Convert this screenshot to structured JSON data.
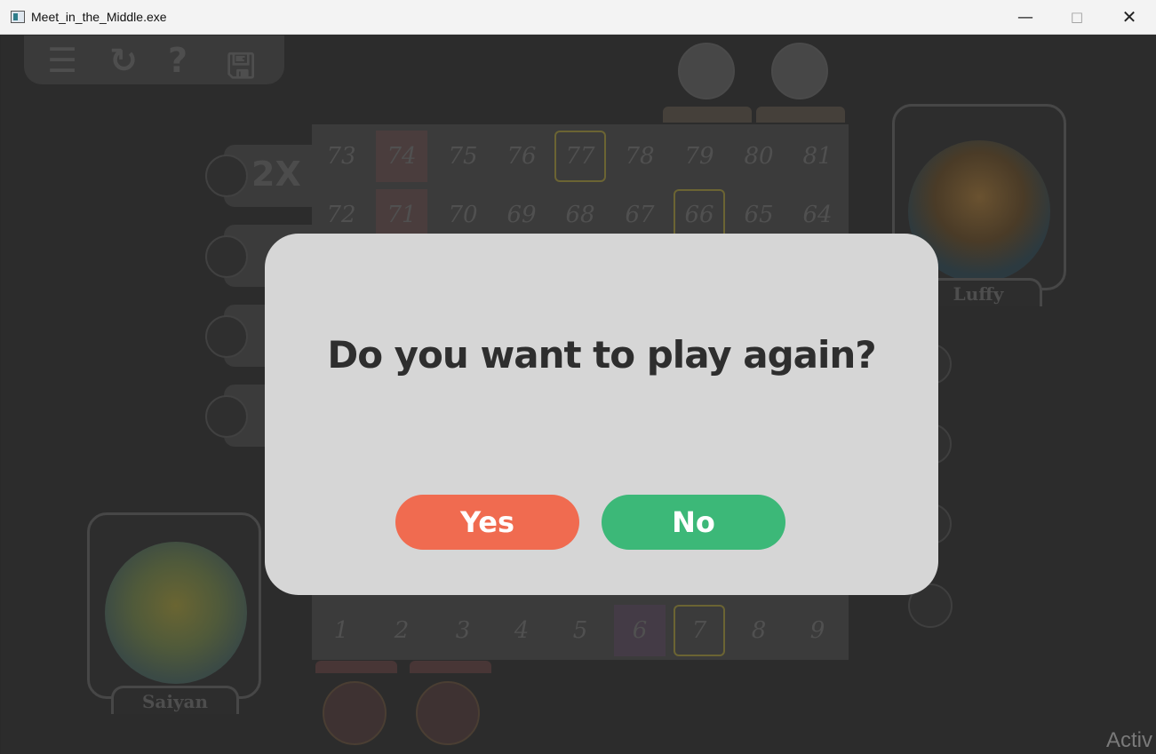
{
  "window": {
    "title": "Meet_in_the_Middle.exe"
  },
  "toolbar": {
    "icons": [
      "menu-icon",
      "restart-icon",
      "help-icon",
      "save-icon"
    ]
  },
  "board": {
    "top_row": [
      "73",
      "74",
      "75",
      "76",
      "77",
      "78",
      "79",
      "80",
      "81"
    ],
    "second_row": [
      "72",
      "71",
      "70",
      "69",
      "68",
      "67",
      "66",
      "65",
      "64"
    ],
    "bottom_row": [
      "1",
      "2",
      "3",
      "4",
      "5",
      "6",
      "7",
      "8",
      "9"
    ]
  },
  "side_panel": {
    "multiplier_label": "2X"
  },
  "players": {
    "top_player": "Luffy",
    "bottom_player": "Saiyan"
  },
  "dialog": {
    "question": "Do you want to play again?",
    "yes_label": "Yes",
    "no_label": "No"
  },
  "watermark": "Activ",
  "colors": {
    "yes": "#f06b50",
    "no": "#3cb878",
    "dialog_bg": "#d6d6d6",
    "overlay": "#2a2a2a"
  }
}
